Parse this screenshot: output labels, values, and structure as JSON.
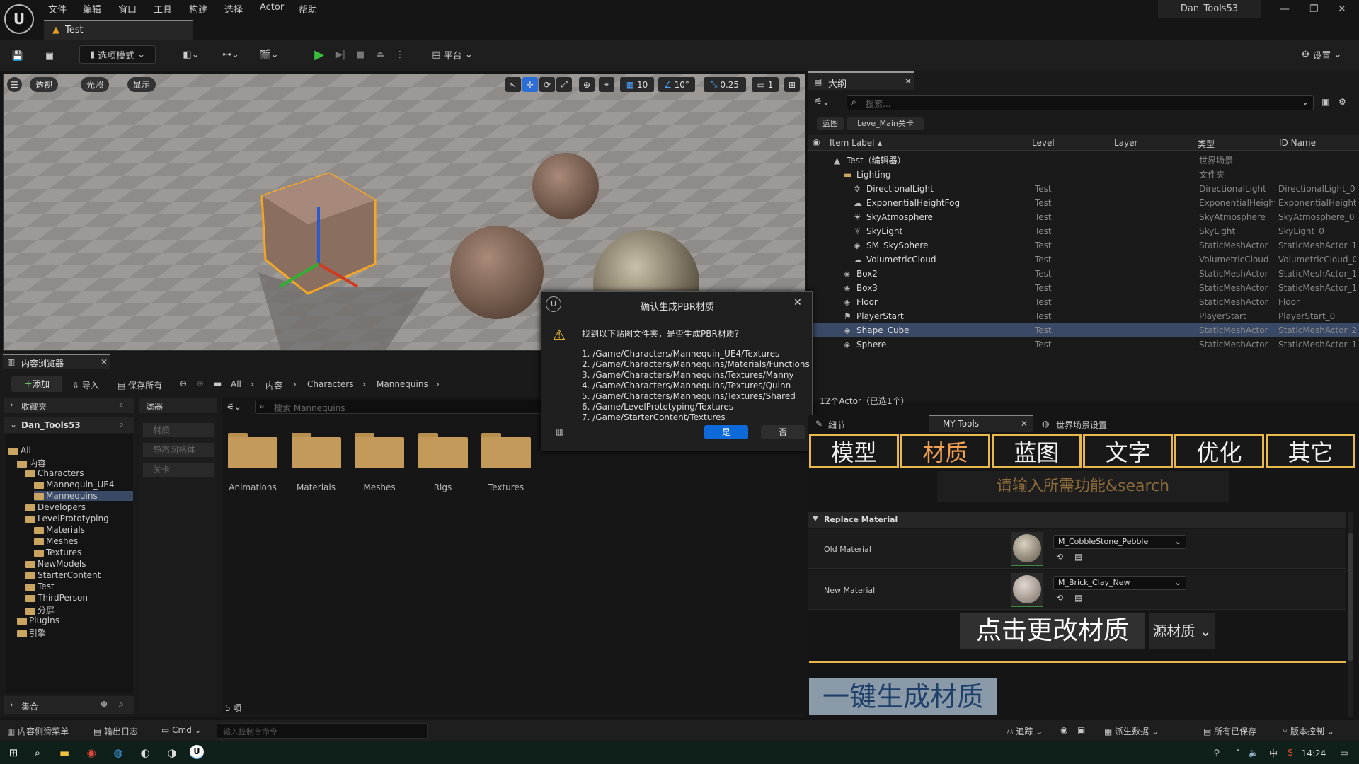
{
  "window": {
    "title": "Dan_Tools53",
    "menu": [
      "文件",
      "编辑",
      "窗口",
      "工具",
      "构建",
      "选择",
      "Actor",
      "帮助"
    ],
    "doc_tab": "Test"
  },
  "toolbar": {
    "mode": "选项模式",
    "platform": "平台",
    "settings": "设置"
  },
  "viewport": {
    "btns": [
      "透视",
      "光照",
      "显示"
    ],
    "grid": "10",
    "angle": "10°",
    "scale": "0.25",
    "cam": "1"
  },
  "outliner": {
    "title": "大纲",
    "search_placeholder": "搜索...",
    "chips": [
      "蓝图",
      "Leve_Main关卡"
    ],
    "cols": [
      "Item Label",
      "Level",
      "Layer",
      "类型",
      "ID Name"
    ],
    "rows": [
      {
        "label": "Test（编辑器）",
        "level": "",
        "type": "世界场景",
        "id": ""
      },
      {
        "label": "Lighting",
        "level": "",
        "type": "文件夹",
        "id": ""
      },
      {
        "label": "DirectionalLight",
        "level": "Test",
        "type": "DirectionalLight",
        "id": "DirectionalLight_0"
      },
      {
        "label": "ExponentialHeightFog",
        "level": "Test",
        "type": "ExponentialHeightF",
        "id": "ExponentialHeightF"
      },
      {
        "label": "SkyAtmosphere",
        "level": "Test",
        "type": "SkyAtmosphere",
        "id": "SkyAtmosphere_0"
      },
      {
        "label": "SkyLight",
        "level": "Test",
        "type": "SkyLight",
        "id": "SkyLight_0"
      },
      {
        "label": "SM_SkySphere",
        "level": "Test",
        "type": "StaticMeshActor",
        "id": "StaticMeshActor_1"
      },
      {
        "label": "VolumetricCloud",
        "level": "Test",
        "type": "VolumetricCloud",
        "id": "VolumetricCloud_0"
      },
      {
        "label": "Box2",
        "level": "Test",
        "type": "StaticMeshActor",
        "id": "StaticMeshActor_1"
      },
      {
        "label": "Box3",
        "level": "Test",
        "type": "StaticMeshActor",
        "id": "StaticMeshActor_1"
      },
      {
        "label": "Floor",
        "level": "Test",
        "type": "StaticMeshActor",
        "id": "Floor"
      },
      {
        "label": "PlayerStart",
        "level": "Test",
        "type": "PlayerStart",
        "id": "PlayerStart_0"
      },
      {
        "label": "Shape_Cube",
        "level": "Test",
        "type": "StaticMeshActor",
        "id": "StaticMeshActor_2"
      },
      {
        "label": "Sphere",
        "level": "Test",
        "type": "StaticMeshActor",
        "id": "StaticMeshActor_1"
      }
    ],
    "count": "12个Actor（已选1个）"
  },
  "content": {
    "title": "内容浏览器",
    "add": "添加",
    "import": "导入",
    "saveall": "保存所有",
    "path": [
      "All",
      "内容",
      "Characters",
      "Mannequins"
    ],
    "favorites": "收藏夹",
    "project": "Dan_Tools53",
    "filters": "滤器",
    "filter_items": [
      "材质",
      "静态网格体",
      "关卡"
    ],
    "search_placeholder": "搜索 Mannequins",
    "tree": [
      "All",
      "内容",
      "Characters",
      "Mannequin_UE4",
      "Mannequins",
      "Developers",
      "LevelPrototyping",
      "Materials",
      "Meshes",
      "Textures",
      "NewModels",
      "StarterContent",
      "Test",
      "ThirdPerson",
      "分屏",
      "Plugins",
      "引擎"
    ],
    "folders": [
      "Animations",
      "Materials",
      "Meshes",
      "Rigs",
      "Textures"
    ],
    "count": "5 项",
    "collections": "集合"
  },
  "dialog": {
    "title": "确认生成PBR材质",
    "message": "找到以下贴图文件夹，是否生成PBR材质？",
    "paths": [
      "1. /Game/Characters/Mannequin_UE4/Textures",
      "2. /Game/Characters/Mannequins/Materials/Functions",
      "3. /Game/Characters/Mannequins/Textures/Manny",
      "4. /Game/Characters/Mannequins/Textures/Quinn",
      "5. /Game/Characters/Mannequins/Textures/Shared",
      "6. /Game/LevelPrototyping/Textures",
      "7. /Game/StarterContent/Textures"
    ],
    "yes": "是",
    "no": "否"
  },
  "details": {
    "tabs": [
      "细节",
      "MY Tools",
      "世界场景设置"
    ],
    "big_tabs": [
      "模型",
      "材质",
      "蓝图",
      "文字",
      "优化",
      "其它"
    ],
    "search_hint": "请输入所需功能&search",
    "section": "Replace Material",
    "old_label": "Old Material",
    "old_value": "M_CobbleStone_Pebble",
    "new_label": "New Material",
    "new_value": "M_Brick_Clay_New",
    "change_btn": "点击更改材质",
    "source_dropdown": "源材质",
    "gen_btn": "一键生成材质"
  },
  "status": {
    "drawer": "内容侧滑菜单",
    "log": "输出日志",
    "cmd": "Cmd",
    "console_placeholder": "输入控制台命令",
    "trace": "追踪",
    "derived": "派生数据",
    "saved": "所有已保存",
    "vc": "版本控制"
  },
  "taskbar": {
    "time": "14:24"
  }
}
